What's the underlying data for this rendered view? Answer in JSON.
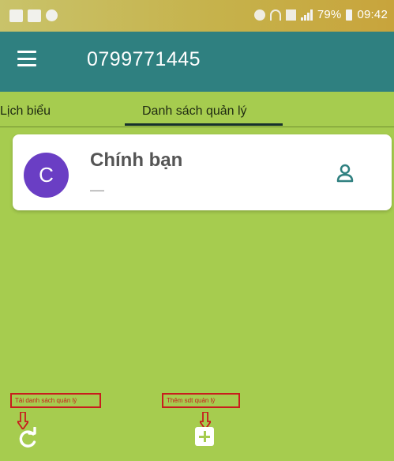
{
  "colors": {
    "app_bar": "#2f8080",
    "background": "#a6cc4f",
    "avatar": "#6a3ec4",
    "callout": "#c81d1d",
    "status_bar": "#c6b24b"
  },
  "status_bar": {
    "battery": "79%",
    "time": "09:42",
    "icons": [
      "gallery-icon",
      "chat-icon",
      "sync-icon",
      "alarm-icon",
      "wifi-icon",
      "data-icon",
      "signal-icon",
      "battery-icon"
    ]
  },
  "app_bar": {
    "menu_icon": "hamburger-menu-icon",
    "title": "0799771445"
  },
  "tabs": [
    {
      "label": "Lịch biểu",
      "selected": false
    },
    {
      "label": "Danh sách quản lý",
      "selected": true
    }
  ],
  "card": {
    "avatar_letter": "C",
    "name": "Chính bạn",
    "subtitle": "—",
    "action_icon": "person-icon"
  },
  "bottom": {
    "reload_callout": "Tải danh sách quản lý",
    "add_callout": "Thêm sdt quản lý",
    "reload_icon": "refresh-icon",
    "add_icon": "plus-icon"
  }
}
